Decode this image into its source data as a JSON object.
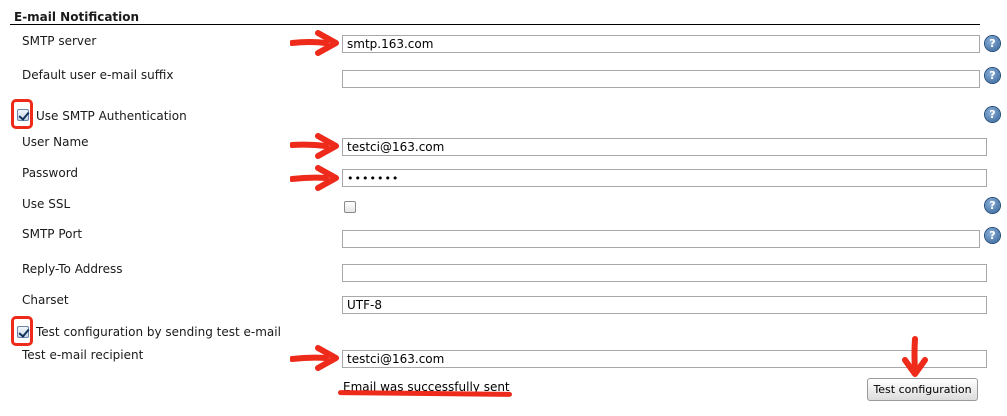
{
  "section": {
    "title": "E-mail Notification"
  },
  "fields": {
    "smtp_server": {
      "label": "SMTP server",
      "value": "smtp.163.com"
    },
    "default_suffix": {
      "label": "Default user e-mail suffix",
      "value": ""
    },
    "use_smtp_auth": {
      "label": "Use SMTP Authentication",
      "checked": true
    },
    "user_name": {
      "label": "User Name",
      "value": "testci@163.com"
    },
    "password": {
      "label": "Password",
      "value": "•••••••"
    },
    "use_ssl": {
      "label": "Use SSL",
      "checked": false
    },
    "smtp_port": {
      "label": "SMTP Port",
      "value": ""
    },
    "reply_to": {
      "label": "Reply-To Address",
      "value": ""
    },
    "charset": {
      "label": "Charset",
      "value": "UTF-8"
    },
    "test_config": {
      "label": "Test configuration by sending test e-mail",
      "checked": true
    },
    "test_recipient": {
      "label": "Test e-mail recipient",
      "value": "testci@163.com"
    }
  },
  "status": {
    "message": "Email was successfully sent"
  },
  "buttons": {
    "test_configuration": "Test configuration"
  },
  "icons": {
    "help": "help-icon",
    "annotation": "red-arrow-icon"
  },
  "colors": {
    "annotation": "#ee2a1b",
    "help": "#2f5f96"
  }
}
